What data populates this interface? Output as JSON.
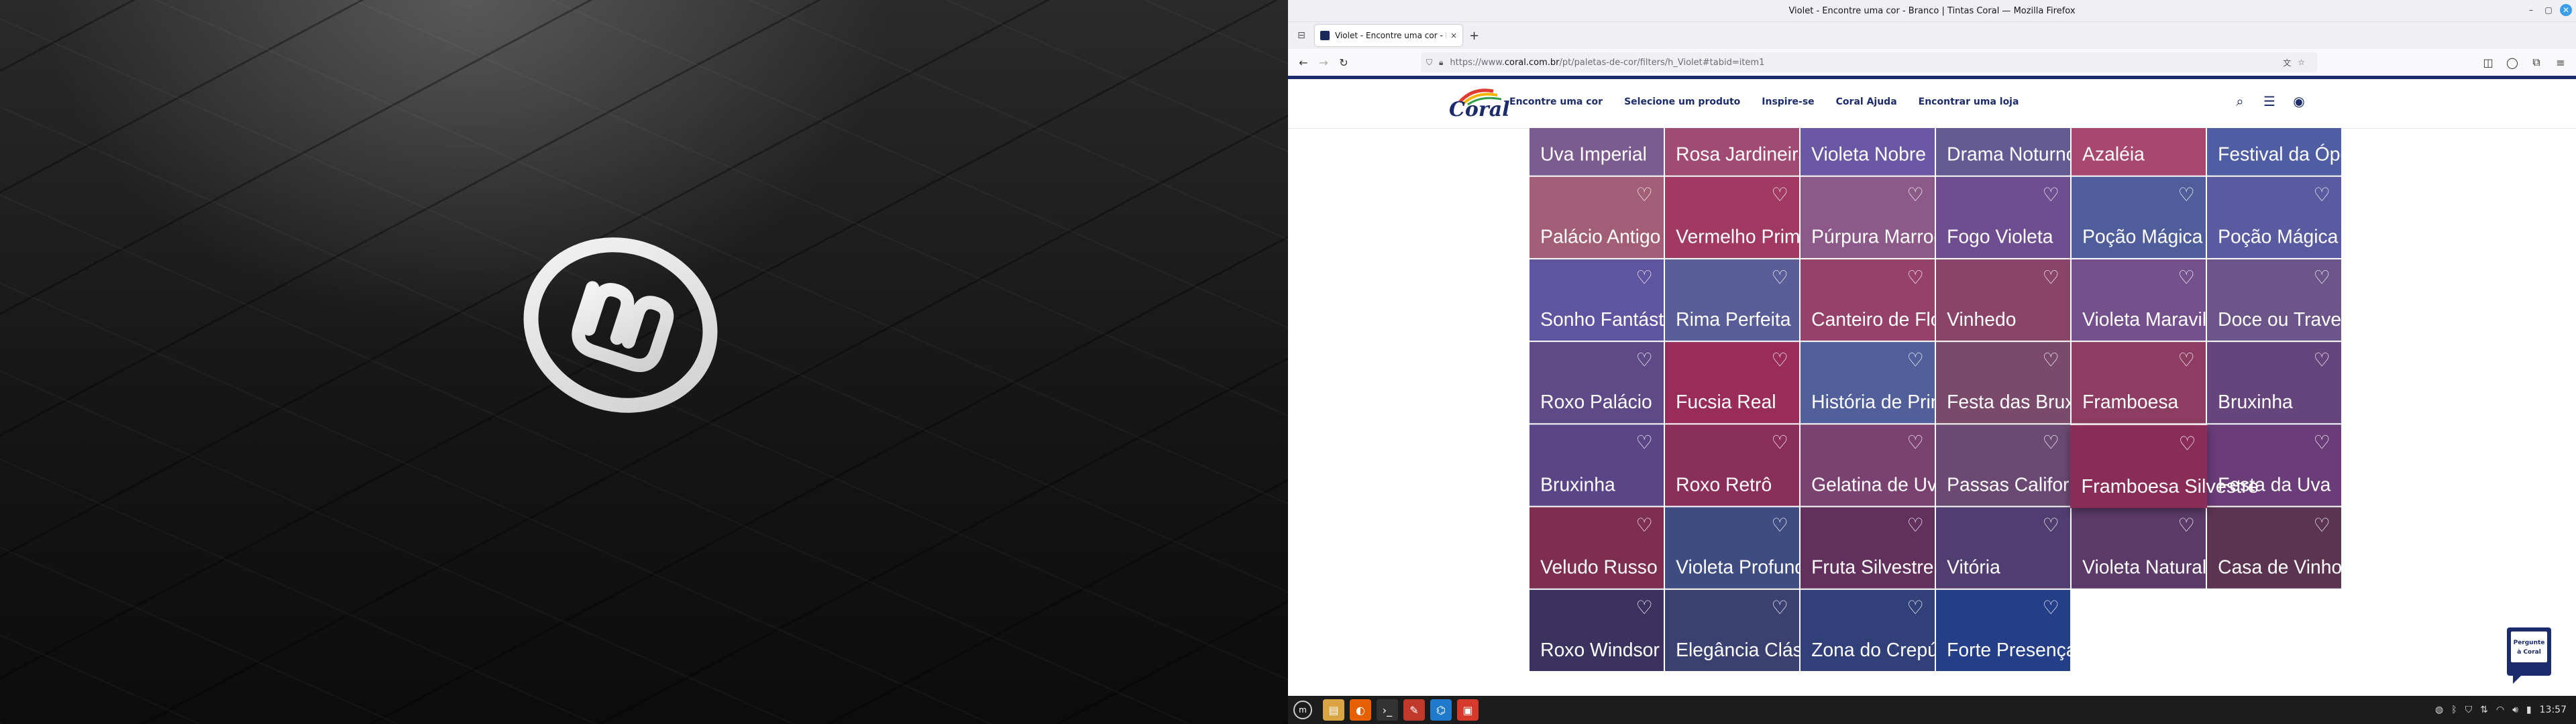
{
  "window": {
    "title": "Violet - Encontre uma cor - Branco | Tintas Coral — Mozilla Firefox",
    "controls": [
      "minimize-icon",
      "maximize-icon",
      "close-icon"
    ]
  },
  "tab": {
    "label": "Violet - Encontre uma cor - B",
    "close": "×",
    "new_tab": "+"
  },
  "address": {
    "url_prefix": "https://www.",
    "url_domain": "coral.com.br",
    "url_rest": "/pt/paletas-de-cor/filters/h_Violet#tabid=item1"
  },
  "site": {
    "logo_text": "Coral",
    "nav": [
      "Encontre uma cor",
      "Selecione um produto",
      "Inspire-se",
      "Coral Ajuda",
      "Encontrar uma loja"
    ],
    "help_badge": [
      "Pergunte",
      "à Coral"
    ]
  },
  "colors": {
    "brand_navy": "#1b2b6b",
    "firefox_close": "#3b9ee8"
  },
  "swatches": [
    {
      "name": "Uva Imperial",
      "color": "#7c5c8e"
    },
    {
      "name": "Rosa Jardineira",
      "color": "#a04a74"
    },
    {
      "name": "Violeta Nobre",
      "color": "#6a58a4"
    },
    {
      "name": "Drama Noturno",
      "color": "#645a94"
    },
    {
      "name": "Azaléia",
      "color": "#a8476f"
    },
    {
      "name": "Festival da Ópera",
      "color": "#4f5ea2"
    },
    {
      "name": "Palácio Antigo",
      "color": "#a25e76"
    },
    {
      "name": "Vermelho Primoroso",
      "color": "#a03a62"
    },
    {
      "name": "Púrpura Marroquina",
      "color": "#8c5a88"
    },
    {
      "name": "Fogo Violeta",
      "color": "#6e4e90"
    },
    {
      "name": "Poção Mágica",
      "color": "#4f5e9a"
    },
    {
      "name": "Poção Mágica",
      "color": "#5a5aa0"
    },
    {
      "name": "Sonho Fantástico",
      "color": "#5f54a0"
    },
    {
      "name": "Rima Perfeita",
      "color": "#5a5e98"
    },
    {
      "name": "Canteiro de Flores",
      "color": "#96416a"
    },
    {
      "name": "Vinhedo",
      "color": "#8a4468"
    },
    {
      "name": "Violeta Maravilhosa",
      "color": "#74508c"
    },
    {
      "name": "Doce ou Travessura",
      "color": "#6c5588"
    },
    {
      "name": "Roxo Palácio",
      "color": "#5e4a86"
    },
    {
      "name": "Fucsia Real",
      "color": "#9a2c5a"
    },
    {
      "name": "História de Princesa",
      "color": "#51609a"
    },
    {
      "name": "Festa das Bruxas",
      "color": "#7a4a6c"
    },
    {
      "name": "Framboesa",
      "color": "#8e3d62"
    },
    {
      "name": "Bruxinha",
      "color": "#66457c"
    },
    {
      "name": "Bruxinha",
      "color": "#5a4686"
    },
    {
      "name": "Roxo Retrô",
      "color": "#8a2f5a"
    },
    {
      "name": "Gelatina de Uva",
      "color": "#7a4270"
    },
    {
      "name": "Passas Californianas",
      "color": "#6a4a72"
    },
    {
      "name": "Framboesa Silvestre",
      "color": "#8a2c58"
    },
    {
      "name": "Festa da Uva",
      "color": "#6a3c78"
    },
    {
      "name": "Veludo Russo",
      "color": "#7e2e50"
    },
    {
      "name": "Violeta Profundo",
      "color": "#3e4c82"
    },
    {
      "name": "Fruta Silvestre",
      "color": "#62305c"
    },
    {
      "name": "Vitória",
      "color": "#503e70"
    },
    {
      "name": "Violeta Natural",
      "color": "#5c3a68"
    },
    {
      "name": "Casa de Vinho",
      "color": "#5a3450"
    },
    {
      "name": "Roxo Windsor",
      "color": "#3c3260"
    },
    {
      "name": "Elegância Clássica",
      "color": "#3a4070"
    },
    {
      "name": "Zona do Crepúsculo",
      "color": "#32407a"
    },
    {
      "name": "Forte Presença",
      "color": "#243e88"
    }
  ],
  "taskbar": {
    "apps": [
      "mint-menu-icon",
      "files-icon",
      "firefox-icon",
      "terminal-icon",
      "text-editor-icon",
      "vscode-icon",
      "office-icon"
    ],
    "clock": "13:57"
  }
}
